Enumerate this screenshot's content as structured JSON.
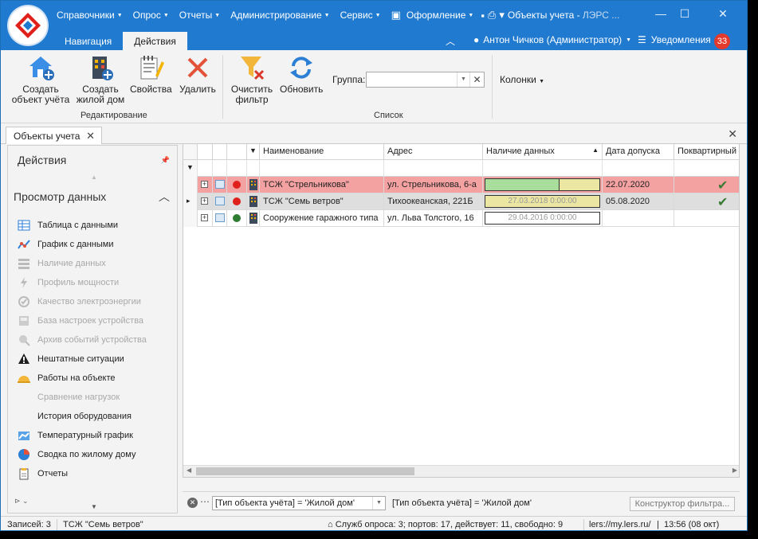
{
  "window": {
    "title": "Объекты учета",
    "subtitle": "ЛЭРС ...",
    "menu": [
      {
        "label": "Справочники"
      },
      {
        "label": "Опрос"
      },
      {
        "label": "Отчеты"
      },
      {
        "label": "Администрирование"
      },
      {
        "label": "Сервис"
      },
      {
        "label": "Оформление"
      }
    ],
    "ribbon_tabs": [
      {
        "label": "Навигация",
        "active": false
      },
      {
        "label": "Действия",
        "active": true
      }
    ],
    "user": "Антон Чичков (Администратор)",
    "notifications_label": "Уведомления",
    "notifications_count": "33"
  },
  "ribbon": {
    "buttons": [
      {
        "label": "Создать\nобъект учёта",
        "icon": "house-add-icon"
      },
      {
        "label": "Создать\nжилой дом",
        "icon": "building-add-icon"
      },
      {
        "label": "Свойства",
        "icon": "properties-icon"
      },
      {
        "label": "Удалить",
        "icon": "delete-x-icon"
      },
      {
        "label": "Очистить\nфильтр",
        "icon": "clear-filter-icon"
      },
      {
        "label": "Обновить",
        "icon": "refresh-icon"
      }
    ],
    "group_edit": "Редактирование",
    "group_list": "Список",
    "group_field_label": "Группа:",
    "group_field_value": "",
    "columns_label": "Колонки"
  },
  "doc_tab": {
    "label": "Объекты учета"
  },
  "left_panel": {
    "title": "Действия",
    "section": "Просмотр данных",
    "items": [
      {
        "label": "Таблица с данными",
        "icon": "table-icon",
        "enabled": true
      },
      {
        "label": "График с данными",
        "icon": "chart-icon",
        "enabled": true
      },
      {
        "label": "Наличие данных",
        "icon": "data-availability-icon",
        "enabled": false
      },
      {
        "label": "Профиль мощности",
        "icon": "lightning-icon",
        "enabled": false
      },
      {
        "label": "Качество электроэнергии",
        "icon": "quality-icon",
        "enabled": false
      },
      {
        "label": "База настроек устройства",
        "icon": "device-settings-icon",
        "enabled": false
      },
      {
        "label": "Архив событий устройства",
        "icon": "event-archive-icon",
        "enabled": false
      },
      {
        "label": "Нештатные ситуации",
        "icon": "warning-icon",
        "enabled": true
      },
      {
        "label": "Работы на объекте",
        "icon": "helmet-icon",
        "enabled": true
      },
      {
        "label": "Сравнение нагрузок",
        "icon": "",
        "enabled": false
      },
      {
        "label": "История оборудования",
        "icon": "",
        "enabled": true
      },
      {
        "label": "Температурный график",
        "icon": "temperature-chart-icon",
        "enabled": true
      },
      {
        "label": "Сводка по жилому дому",
        "icon": "pie-summary-icon",
        "enabled": true
      },
      {
        "label": "Отчеты",
        "icon": "report-icon",
        "enabled": true
      }
    ]
  },
  "grid": {
    "columns": [
      "",
      "",
      "",
      "",
      "Наименование",
      "Адрес",
      "Наличие данных",
      "Дата допуска",
      "Поквартирный"
    ],
    "rows": [
      {
        "name": "ТСЖ \"Стрельникова\"",
        "address": "ул. Стрельникова, 6-а",
        "availability": "",
        "availability_green_fraction": 0.65,
        "date": "22.07.2020",
        "flat": true,
        "status_color": "#e0201b",
        "row_bg": "#f4a1a1",
        "current": false
      },
      {
        "name": "ТСЖ \"Семь ветров\"",
        "address": "Тихоокеанская, 221Б",
        "availability": "27.03.2018 0:00:00",
        "availability_green_fraction": 0,
        "date": "05.08.2020",
        "flat": true,
        "status_color": "#e0201b",
        "row_bg": "#dedede",
        "current": true
      },
      {
        "name": "Сооружение гаражного типа",
        "address": "ул. Льва Толстого, 16",
        "availability": "29.04.2016 0:00:00",
        "availability_green_fraction": 0,
        "date": "",
        "flat": false,
        "status_color": "#2e7d32",
        "row_bg": "#ffffff",
        "current": false
      }
    ]
  },
  "filter": {
    "combo_value": "[Тип объекта учёта] = 'Жилой дом'",
    "text": "[Тип объекта учёта] = 'Жилой дом'",
    "builder_label": "Конструктор фильтра..."
  },
  "status": {
    "records": "Записей: 3",
    "current": "ТСЖ \"Семь ветров\"",
    "services": "Служб опроса: 3; портов: 17, действует: 11, свободно: 9",
    "server": "lers://my.lers.ru/",
    "time": "13:56 (08 окт)"
  },
  "colors": {
    "accent": "#1f7ad0",
    "error_row": "#f4a1a1",
    "availability_green": "#a9dd9b",
    "availability_yellow": "#ece6a3"
  }
}
